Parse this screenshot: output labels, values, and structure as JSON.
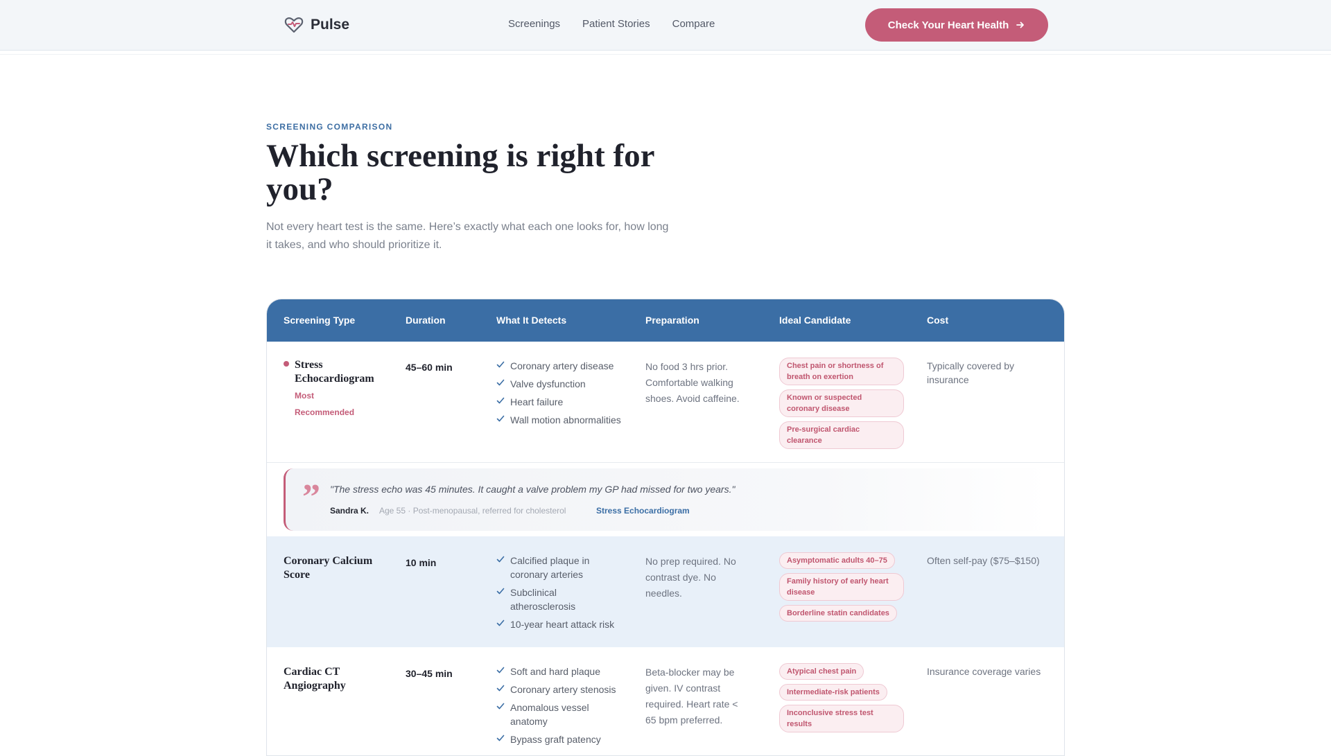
{
  "nav": {
    "brand": "Pulse",
    "links": [
      "Screenings",
      "Patient Stories",
      "Compare"
    ],
    "cta": "Check Your Heart Health"
  },
  "hero": {
    "eyebrow": "SCREENING COMPARISON",
    "title": "Which screening is right for you?",
    "lead": "Not every heart test is the same. Here’s exactly what each one looks for, how long it takes, and who should prioritize it."
  },
  "table": {
    "headers": [
      "Screening Type",
      "Duration",
      "What It Detects",
      "Preparation",
      "Ideal Candidate",
      "Cost"
    ],
    "rows": [
      {
        "name": "Stress Echocardiogram",
        "badge_line1": "Most",
        "badge_line2": "Recommended",
        "duration": "45–60 min",
        "detects": [
          "Coronary artery disease",
          "Valve dysfunction",
          "Heart failure",
          "Wall motion abnormalities"
        ],
        "prep": "No food 3 hrs prior. Comfortable walking shoes. Avoid caffeine.",
        "tags": [
          "Chest pain or shortness of breath on exertion",
          "Known or suspected coronary disease",
          "Pre-surgical cardiac clearance"
        ],
        "cost": "Typically covered by insurance"
      },
      {
        "name": "Coronary Calcium Score",
        "duration": "10 min",
        "detects": [
          "Calcified plaque in coronary arteries",
          "Subclinical atherosclerosis",
          "10-year heart attack risk"
        ],
        "prep": "No prep required. No contrast dye. No needles.",
        "tags": [
          "Asymptomatic adults 40–75",
          "Family history of early heart disease",
          "Borderline statin candidates"
        ],
        "cost": "Often self-pay ($75–$150)"
      },
      {
        "name": "Cardiac CT Angiography",
        "duration": "30–45 min",
        "detects": [
          "Soft and hard plaque",
          "Coronary artery stenosis",
          "Anomalous vessel anatomy",
          "Bypass graft patency"
        ],
        "prep": "Beta-blocker may be given. IV contrast required. Heart rate < 65 bpm preferred.",
        "tags": [
          "Atypical chest pain",
          "Intermediate-risk patients",
          "Inconclusive stress test results"
        ],
        "cost": "Insurance coverage varies"
      }
    ],
    "quote": {
      "text": "\"The stress echo was 45 minutes. It caught a valve problem my GP had missed for two years.\"",
      "author": "Sandra K.",
      "meta": "Age 55 · Post-menopausal, referred for cholesterol",
      "link": "Stress Echocardiogram"
    }
  },
  "colors": {
    "accent": "#c45c78",
    "primary": "#3b6ea5",
    "highlight_row": "#e8f0f9"
  }
}
